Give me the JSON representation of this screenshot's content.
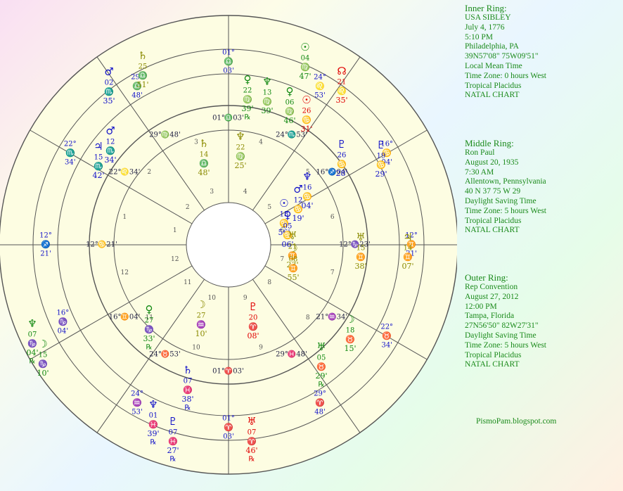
{
  "colors": {
    "red": "#e00000",
    "olive": "#8a8a00",
    "green": "#118811",
    "blue": "#1010c8",
    "ring_fill": "#fdfde2",
    "line": "#555555",
    "info_text": "#1a8a1a"
  },
  "rings": [
    {
      "title": "Inner Ring:",
      "lines": [
        "USA SIBLEY",
        "July 4, 1776",
        "5:10 PM",
        "Philadelphia, PA",
        "39N57'08\"  75W09'51\"",
        "Local Mean Time",
        "Time Zone: 0 hours West",
        "Tropical Placidus",
        "NATAL CHART"
      ]
    },
    {
      "title": "Middle Ring:",
      "lines": [
        "Ron Paul",
        "August 20, 1935",
        "7:30 AM",
        "Allentown, Pennsylvania",
        "40 N 37     75 W 29",
        "Daylight Saving Time",
        "Time Zone: 5 hours West",
        "Tropical Placidus",
        "NATAL CHART"
      ]
    },
    {
      "title": "Outer Ring:",
      "lines": [
        "Rep Convention",
        "August 27, 2012",
        "12:00 PM",
        "Tampa, Florida",
        "27N56'50\"  82W27'31\"",
        "Daylight Saving Time",
        "Time Zone: 5 hours West",
        "Tropical Placidus",
        "NATAL CHART"
      ]
    }
  ],
  "credit": "PismoPam.blogspot.com",
  "house_numbers": [
    "1",
    "2",
    "3",
    "4",
    "5",
    "6",
    "7",
    "8",
    "9",
    "10",
    "11",
    "12"
  ],
  "inner_cusps": [
    {
      "deg": "01°",
      "sign": "♎",
      "min": "03'"
    },
    {
      "deg": "24°",
      "sign": "♏",
      "min": "53'"
    },
    {
      "deg": "16°",
      "sign": "♐",
      "min": "04'"
    },
    {
      "deg": "12°",
      "sign": "♑",
      "min": "23'"
    },
    {
      "deg": "21°",
      "sign": "♒",
      "min": "34'"
    },
    {
      "deg": "29°",
      "sign": "♓",
      "min": "48'"
    },
    {
      "deg": "01°",
      "sign": "♈",
      "min": "03'"
    },
    {
      "deg": "24°",
      "sign": "♉",
      "min": "53'"
    },
    {
      "deg": "16°",
      "sign": "♊",
      "min": "04'"
    },
    {
      "deg": "12°",
      "sign": "♋",
      "min": "21'"
    },
    {
      "deg": "22°",
      "sign": "♌",
      "min": "34'"
    },
    {
      "deg": "29°",
      "sign": "♍",
      "min": "48'"
    }
  ],
  "outer_cusps": [
    {
      "deg": "12°",
      "sign": "♐",
      "min": "21'"
    },
    {
      "deg": "16°",
      "sign": "♑",
      "min": "04'"
    },
    {
      "deg": "24°",
      "sign": "♒",
      "min": "53'"
    },
    {
      "deg": "01°",
      "sign": "♈",
      "min": "03'"
    },
    {
      "deg": "29°",
      "sign": "♈",
      "min": "48'"
    },
    {
      "deg": "22°",
      "sign": "♉",
      "min": "34'"
    },
    {
      "deg": "12°",
      "sign": "♊",
      "min": "21'"
    },
    {
      "deg": "16°",
      "sign": "♋",
      "min": "04'"
    },
    {
      "deg": "24°",
      "sign": "♌",
      "min": "53'"
    },
    {
      "deg": "01°",
      "sign": "♎",
      "min": "03'"
    },
    {
      "deg": "29°",
      "sign": "♎",
      "min": "48'"
    },
    {
      "deg": "22°",
      "sign": "♏",
      "min": "34'"
    }
  ],
  "planets": [
    {
      "glyph": "☉",
      "deg": "04",
      "sign": "♍",
      "min": "47'",
      "color": "green",
      "ring": "outer"
    },
    {
      "glyph": "☊",
      "deg": "21",
      "sign": "♌",
      "min": "35'",
      "color": "red",
      "ring": "outer"
    },
    {
      "glyph": "☉",
      "deg": "26",
      "sign": "♋",
      "min": "31'",
      "color": "red",
      "ring": "outer"
    },
    {
      "glyph": "♀",
      "deg": "06",
      "sign": "♍",
      "min": "46'",
      "color": "green",
      "ring": "outer"
    },
    {
      "glyph": "♆",
      "deg": "13",
      "sign": "♍",
      "min": "39'",
      "color": "green",
      "ring": "outer"
    },
    {
      "glyph": "♀",
      "deg": "22",
      "sign": "♍",
      "min": "39'",
      "retro": "℞",
      "color": "green",
      "ring": "outer"
    },
    {
      "glyph": "♄",
      "deg": "25",
      "sign": "♎",
      "min": "51'",
      "color": "olive",
      "ring": "outer"
    },
    {
      "glyph": "♂",
      "deg": "02",
      "sign": "♏",
      "min": "35'",
      "color": "blue",
      "ring": "outer"
    },
    {
      "glyph": "♂",
      "deg": "12",
      "sign": "♏",
      "min": "34'",
      "color": "blue",
      "ring": "outer"
    },
    {
      "glyph": "♃",
      "deg": "15",
      "sign": "♏",
      "min": "42'",
      "color": "blue",
      "ring": "outer"
    },
    {
      "glyph": "♆",
      "deg": "07",
      "sign": "♑",
      "min": "04'",
      "retro": "℞",
      "color": "green",
      "ring": "outer"
    },
    {
      "glyph": "☽",
      "deg": "15",
      "sign": "♑",
      "min": "10'",
      "color": "green",
      "ring": "outer"
    },
    {
      "glyph": "♆",
      "deg": "01",
      "sign": "♓",
      "min": "39'",
      "retro": "℞",
      "color": "blue",
      "ring": "outer"
    },
    {
      "glyph": "♇",
      "deg": "07",
      "sign": "♓",
      "min": "27'",
      "retro": "℞",
      "color": "blue",
      "ring": "outer"
    },
    {
      "glyph": "♅",
      "deg": "07",
      "sign": "♈",
      "min": "46'",
      "retro": "℞",
      "color": "red",
      "ring": "outer"
    },
    {
      "glyph": "♅",
      "deg": "05",
      "sign": "♉",
      "min": "29'",
      "retro": "℞",
      "color": "green",
      "ring": "outer"
    },
    {
      "glyph": "☽",
      "deg": "18",
      "sign": "♉",
      "min": "15'",
      "color": "green",
      "ring": "outer"
    },
    {
      "glyph": "♅",
      "deg": "15",
      "sign": "♊",
      "min": "38'",
      "color": "olive",
      "ring": "outer"
    },
    {
      "glyph": "♃",
      "deg": "14",
      "sign": "♊",
      "min": "07'",
      "color": "olive",
      "ring": "outer"
    },
    {
      "glyph": "♇",
      "deg": "19",
      "sign": "♋",
      "min": "29'",
      "color": "blue",
      "ring": "outer"
    },
    {
      "glyph": "♇",
      "deg": "26",
      "sign": "♋",
      "min": "28'",
      "color": "blue",
      "ring": "outer"
    },
    {
      "glyph": "♄",
      "deg": "14",
      "sign": "♎",
      "min": "48'",
      "color": "olive",
      "ring": "middle"
    },
    {
      "glyph": "♆",
      "deg": "22",
      "sign": "♍",
      "min": "25'",
      "color": "olive",
      "ring": "middle"
    },
    {
      "glyph": "♆",
      "deg": "16",
      "sign": "♋",
      "min": "04'",
      "color": "blue",
      "ring": "middle"
    },
    {
      "glyph": "♂",
      "deg": "12",
      "sign": "♋",
      "min": "19'",
      "color": "blue",
      "ring": "middle"
    },
    {
      "glyph": "☉",
      "deg": "13",
      "sign": "♋",
      "min": "56'",
      "color": "blue",
      "ring": "middle"
    },
    {
      "glyph": "♀",
      "deg": "05",
      "sign": "♋",
      "min": "06'",
      "color": "blue",
      "ring": "middle"
    },
    {
      "glyph": "♅",
      "deg": "21",
      "sign": "♊",
      "min": "23'",
      "color": "olive",
      "ring": "middle"
    },
    {
      "glyph": "☽",
      "deg": "08",
      "sign": "♊",
      "min": "55'",
      "color": "olive",
      "ring": "middle"
    },
    {
      "glyph": "♀",
      "deg": "27",
      "sign": "♑",
      "min": "33'",
      "retro": "℞",
      "color": "green",
      "ring": "middle"
    },
    {
      "glyph": "☽",
      "deg": "27",
      "sign": "♒",
      "min": "10'",
      "color": "olive",
      "ring": "middle"
    },
    {
      "glyph": "♄",
      "deg": "07",
      "sign": "♓",
      "min": "38'",
      "retro": "℞",
      "color": "blue",
      "ring": "middle"
    },
    {
      "glyph": "♇",
      "deg": "20",
      "sign": "♈",
      "min": "08'",
      "color": "red",
      "ring": "middle"
    }
  ]
}
